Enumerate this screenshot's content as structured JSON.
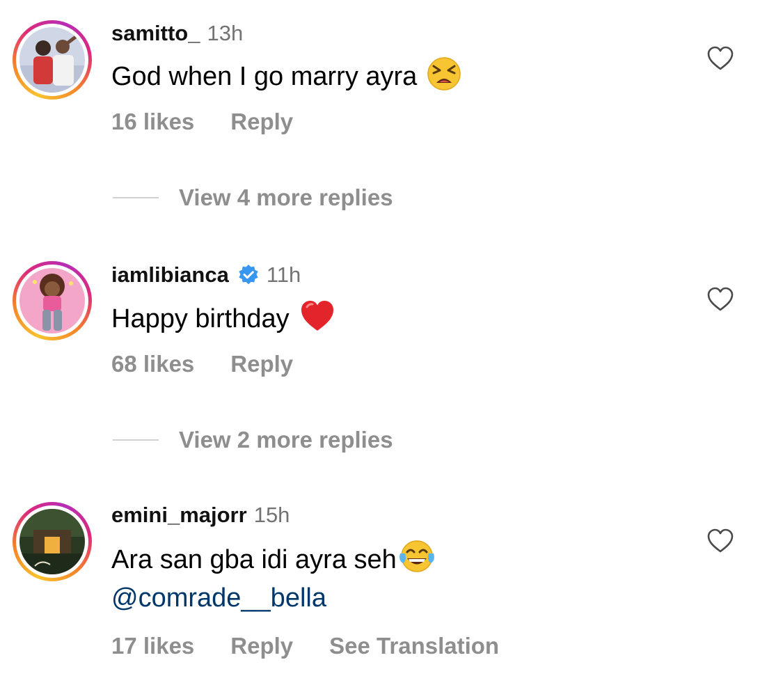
{
  "comments": [
    {
      "username": "samitto_",
      "time": "13h",
      "text": "God when I go marry ayra",
      "emoji": "tired-face-emoji",
      "likes": "16 likes",
      "reply": "Reply",
      "view_replies": "View 4 more replies"
    },
    {
      "username": "iamlibianca",
      "verified": true,
      "time": "11h",
      "text": "Happy birthday",
      "emoji": "red-heart-emoji",
      "likes": "68 likes",
      "reply": "Reply",
      "view_replies": "View 2 more replies"
    },
    {
      "username": "emini_majorr",
      "time": "15h",
      "text": "Ara san gba idi ayra seh",
      "emoji": "tears-of-joy-emoji",
      "mention": "@comrade__bella",
      "likes": "17 likes",
      "reply": "Reply",
      "translate": "See Translation"
    }
  ],
  "colors": {
    "secondary_text": "#8e8e8e",
    "timestamp": "#737373",
    "mention": "#00376b",
    "verified_badge": "#3897f0"
  }
}
